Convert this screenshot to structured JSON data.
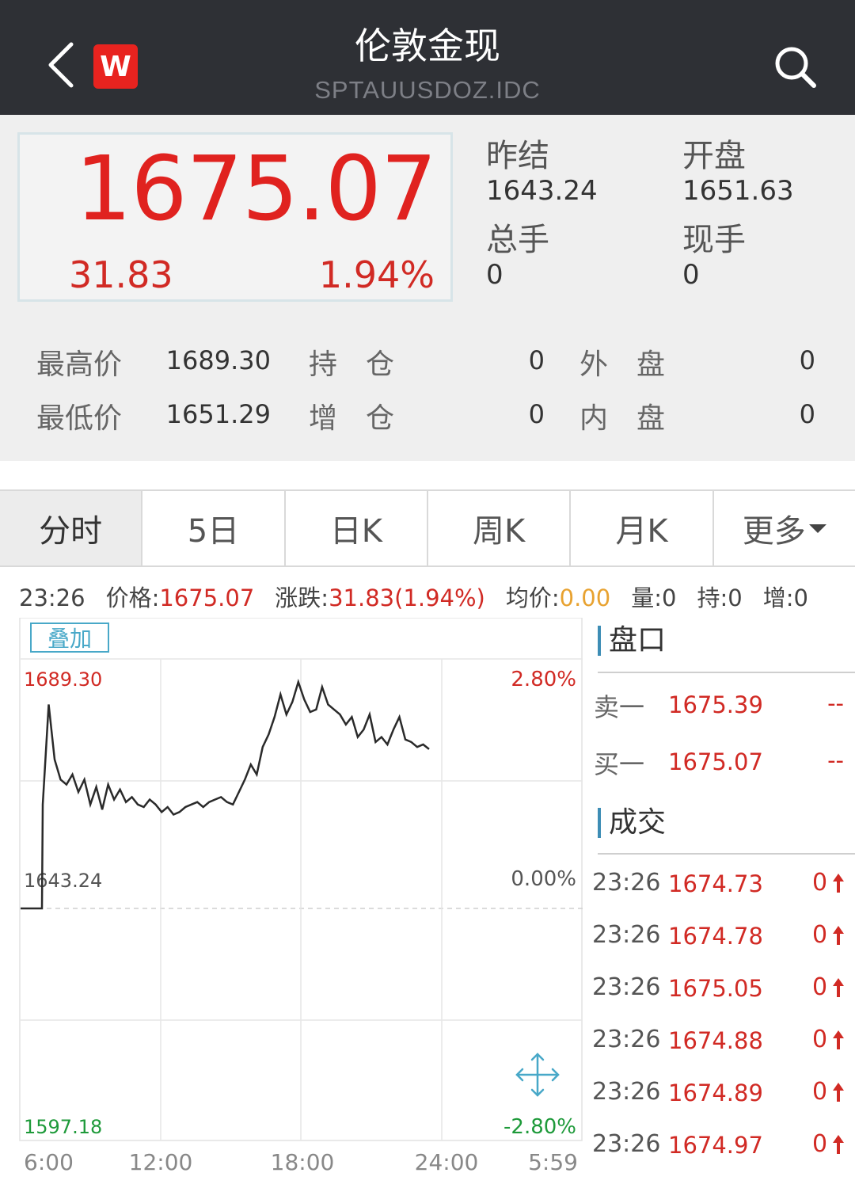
{
  "header": {
    "title": "伦敦金现",
    "subtitle": "SPTAUUSDOZ.IDC",
    "logo_letter": "W",
    "back_icon": "chevron-left-icon",
    "search_icon": "search-icon"
  },
  "quote": {
    "last_price": "1675.07",
    "change": "31.83",
    "change_pct": "1.94%",
    "prev_settle_label": "昨结",
    "prev_settle": "1643.24",
    "open_label": "开盘",
    "open": "1651.63",
    "total_vol_label": "总手",
    "total_vol": "0",
    "cur_vol_label": "现手",
    "cur_vol": "0",
    "high_label": "最高价",
    "high": "1689.30",
    "low_label": "最低价",
    "low": "1651.29",
    "oi_label": "持　仓",
    "oi": "0",
    "oi_chg_label": "增　仓",
    "oi_chg": "0",
    "outer_label": "外　盘",
    "outer": "0",
    "inner_label": "内　盘",
    "inner": "0"
  },
  "tabs": [
    {
      "label": "分时",
      "active": true
    },
    {
      "label": "5日"
    },
    {
      "label": "日K"
    },
    {
      "label": "周K"
    },
    {
      "label": "月K"
    },
    {
      "label": "更多"
    }
  ],
  "info": {
    "time": "23:26",
    "price_label": "价格:",
    "price": "1675.07",
    "chg_label": "涨跌:",
    "chg": "31.83(1.94%)",
    "avg_label": "均价:",
    "avg": "0.00",
    "vol": "量:0",
    "hold": "持:0",
    "add": "增:0"
  },
  "chart": {
    "overlay_label": "叠加",
    "y_top_label": "1689.30",
    "y_mid_label": "1643.24",
    "y_bot_label": "1597.18",
    "pct_top_label": "2.80%",
    "pct_mid_label": "0.00%",
    "pct_bot_label": "-2.80%",
    "x_labels": [
      "6:00",
      "12:00",
      "18:00",
      "24:00",
      "5:59"
    ],
    "expand_icon": "expand-arrows-icon"
  },
  "chart_data": {
    "type": "line",
    "ylim": [
      1597.18,
      1689.3
    ],
    "baseline": 1643.24,
    "x_ticks": [
      "6:00",
      "12:00",
      "18:00",
      "24:00",
      "5:59"
    ],
    "series": [
      {
        "values": [
          1643.24,
          1643.24,
          1643.24,
          1643.24,
          1664.0,
          1684.0,
          1673.0,
          1669.0,
          1668.0,
          1670.0,
          1666.5,
          1669.0,
          1664.0,
          1667.5,
          1663.0,
          1668.0,
          1665.0,
          1667.0,
          1664.5,
          1665.5,
          1664.0,
          1663.5,
          1665.0,
          1664.0,
          1662.5,
          1663.5,
          1662.0,
          1662.5,
          1663.5,
          1664.0,
          1664.5,
          1663.5,
          1664.5,
          1665.0,
          1665.5,
          1664.5,
          1664.0,
          1666.5,
          1669.0,
          1672.0,
          1670.0,
          1675.5,
          1678.0,
          1681.5,
          1686.0,
          1682.0,
          1684.5,
          1688.5,
          1685.0,
          1682.5,
          1683.0,
          1687.5,
          1684.0,
          1683.0,
          1682.0,
          1680.0,
          1681.5,
          1677.5,
          1679.0,
          1682.0,
          1676.5,
          1677.5,
          1676.0,
          1679.0,
          1681.5,
          1677.0,
          1676.5,
          1675.5,
          1676.0,
          1675.07
        ]
      }
    ]
  },
  "orderbook": {
    "title": "盘口",
    "ask_label": "卖一",
    "ask_price": "1675.39",
    "ask_vol": "--",
    "bid_label": "买一",
    "bid_price": "1675.07",
    "bid_vol": "--"
  },
  "trades": {
    "title": "成交",
    "rows": [
      {
        "time": "23:26",
        "price": "1674.73",
        "vol": "0"
      },
      {
        "time": "23:26",
        "price": "1674.78",
        "vol": "0"
      },
      {
        "time": "23:26",
        "price": "1675.05",
        "vol": "0"
      },
      {
        "time": "23:26",
        "price": "1674.88",
        "vol": "0"
      },
      {
        "time": "23:26",
        "price": "1674.89",
        "vol": "0"
      },
      {
        "time": "23:26",
        "price": "1674.97",
        "vol": "0"
      }
    ]
  },
  "colors": {
    "header_bg": "#2e3035",
    "up_red": "#d12a24",
    "down_green": "#1e9a3a",
    "accent_blue": "#48a8c8",
    "avg_orange": "#e8a230"
  }
}
